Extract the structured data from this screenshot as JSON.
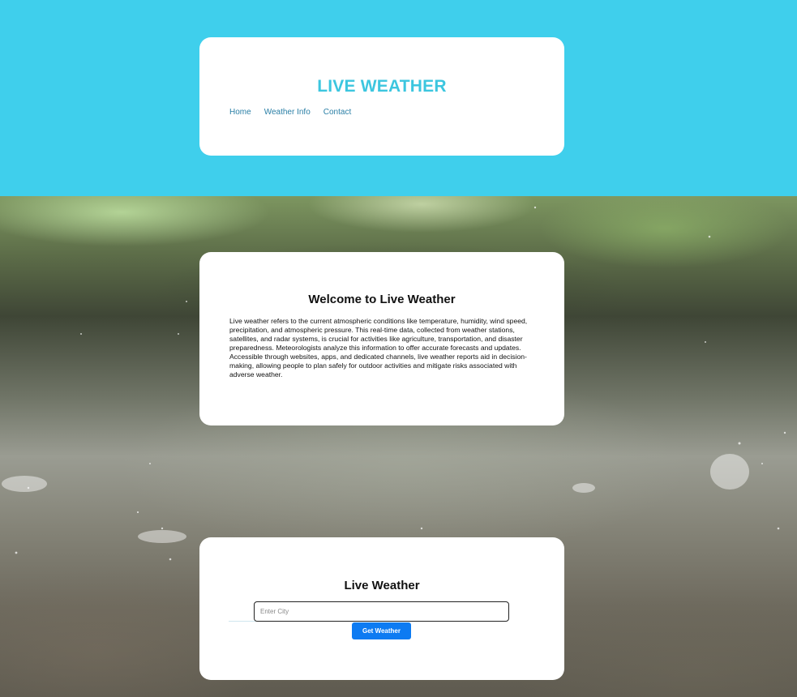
{
  "header": {
    "title": "LIVE WEATHER",
    "nav": [
      "Home",
      "Weather Info",
      "Contact"
    ]
  },
  "welcome": {
    "title": "Welcome to Live Weather",
    "text": "Live weather refers to the current atmospheric conditions like temperature, humidity, wind speed, precipitation, and atmospheric pressure. This real-time data, collected from weather stations, satellites, and radar systems, is crucial for activities like agriculture, transportation, and disaster preparedness. Meteorologists analyze this information to offer accurate forecasts and updates. Accessible through websites, apps, and dedicated channels, live weather reports aid in decision-making, allowing people to plan safely for outdoor activities and mitigate risks associated with adverse weather."
  },
  "search": {
    "title": "Live Weather",
    "placeholder": "Enter City",
    "button_label": "Get Weather"
  },
  "colors": {
    "top_band": "#3fcfec",
    "title": "#3cc6df",
    "nav_link": "#2a7fa6",
    "button": "#0d7bf2"
  }
}
